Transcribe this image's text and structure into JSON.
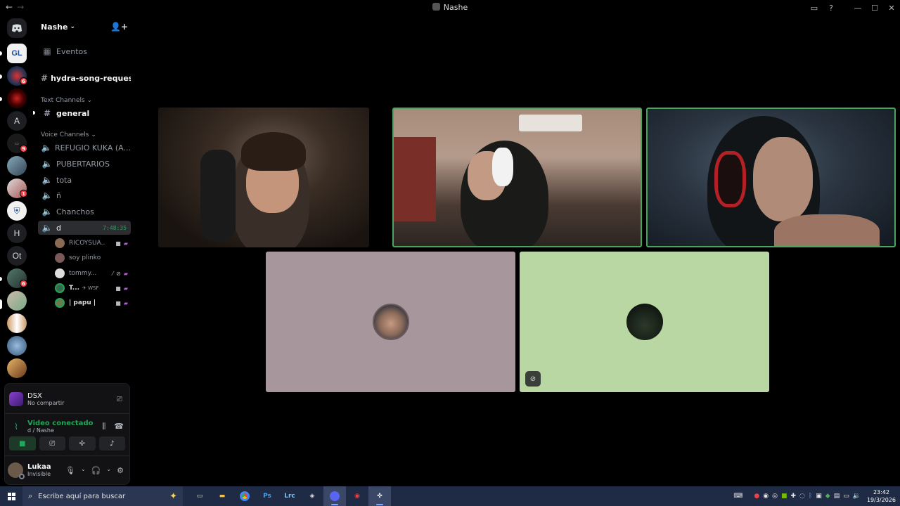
{
  "titlebar": {
    "back": "←",
    "forward": "→",
    "title": "Nashe",
    "inbox_icon": "inbox-icon",
    "help": "?",
    "minimize": "—",
    "maximize": "☐",
    "close": "✕"
  },
  "rail": {
    "letters": [
      "A",
      "H",
      "Ot"
    ],
    "badges": [
      "6",
      "9",
      "1",
      "6"
    ]
  },
  "server": {
    "name": "Nashe",
    "events_label": "Eventos",
    "channel_song": "hydra-song-requests",
    "text_category": "Text Channels",
    "text_channel": "general",
    "voice_category": "Voice Channels",
    "voice_channels": [
      "REFUGIO KUKA (A...",
      "PUBERTARIOS",
      "tota",
      "ñ",
      "Chanchos"
    ],
    "active_voice": "d",
    "timer": "7:48:35",
    "voice_users": [
      "RICOYSUA...",
      "soy plinko",
      "tommy...",
      "T...",
      "| papu |"
    ],
    "wsf_tag": "WSF"
  },
  "panel": {
    "stream_title": "DSX",
    "stream_sub": "No compartir",
    "voice_status": "Video conectado",
    "voice_location": "d / Nashe",
    "username": "Lukaa",
    "user_status": "Invisible"
  },
  "taskbar": {
    "search_placeholder": "Escribe aquí para buscar",
    "apps": [
      "Ps",
      "Lrc"
    ],
    "time": "23:42",
    "date": "19/3/2026"
  },
  "colors": {
    "speaking_border": "#49a55e",
    "tile_mauve": "#a7969b",
    "tile_green": "#b8d7a2",
    "connected_green": "#23a55a"
  }
}
